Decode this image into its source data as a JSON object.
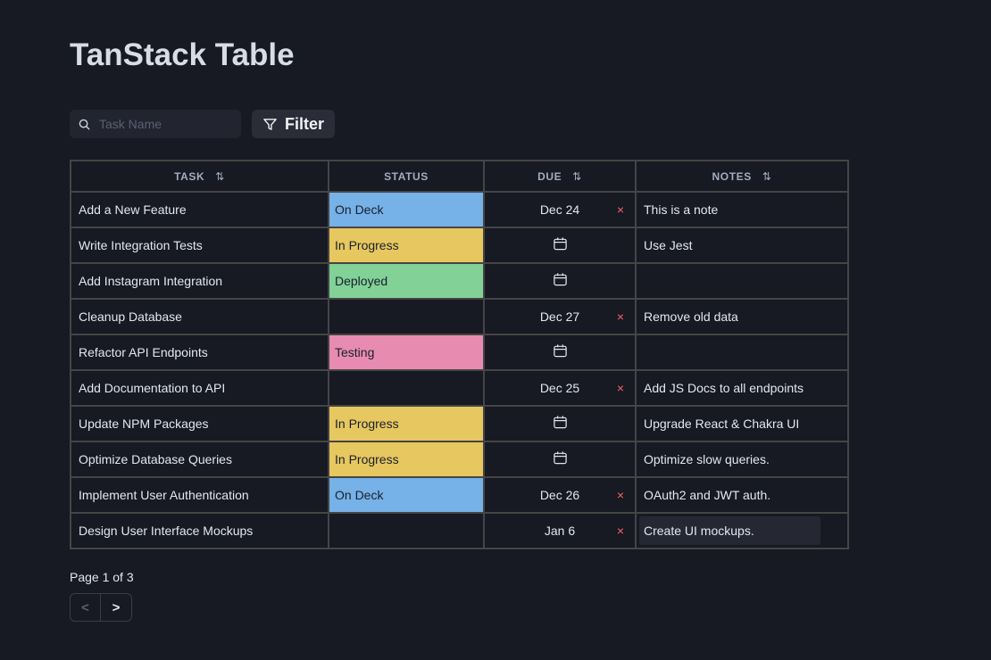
{
  "title": "TanStack Table",
  "search": {
    "placeholder": "Task Name",
    "value": ""
  },
  "filter_label": "Filter",
  "columns": {
    "task": "TASK",
    "status": "STATUS",
    "due": "DUE",
    "notes": "NOTES"
  },
  "status_colors": {
    "On Deck": "#76b1e8",
    "In Progress": "#e7c75f",
    "Deployed": "#82d197",
    "Testing": "#e78cb0"
  },
  "rows": [
    {
      "task": "Add a New Feature",
      "status": "On Deck",
      "due": "Dec 24",
      "notes": "This is a note"
    },
    {
      "task": "Write Integration Tests",
      "status": "In Progress",
      "due": "",
      "notes": "Use Jest"
    },
    {
      "task": "Add Instagram Integration",
      "status": "Deployed",
      "due": "",
      "notes": ""
    },
    {
      "task": "Cleanup Database",
      "status": "",
      "due": "Dec 27",
      "notes": "Remove old data"
    },
    {
      "task": "Refactor API Endpoints",
      "status": "Testing",
      "due": "",
      "notes": ""
    },
    {
      "task": "Add Documentation to API",
      "status": "",
      "due": "Dec 25",
      "notes": "Add JS Docs to all endpoints"
    },
    {
      "task": "Update NPM Packages",
      "status": "In Progress",
      "due": "",
      "notes": "Upgrade React & Chakra UI"
    },
    {
      "task": "Optimize Database Queries",
      "status": "In Progress",
      "due": "",
      "notes": "Optimize slow queries."
    },
    {
      "task": "Implement User Authentication",
      "status": "On Deck",
      "due": "Dec 26",
      "notes": "OAuth2 and JWT auth."
    },
    {
      "task": "Design User Interface Mockups",
      "status": "",
      "due": "Jan 6",
      "notes": "Create UI mockups."
    }
  ],
  "clear_symbol": "×",
  "pagination": {
    "label": "Page 1 of 3",
    "prev": "<",
    "next": ">"
  }
}
